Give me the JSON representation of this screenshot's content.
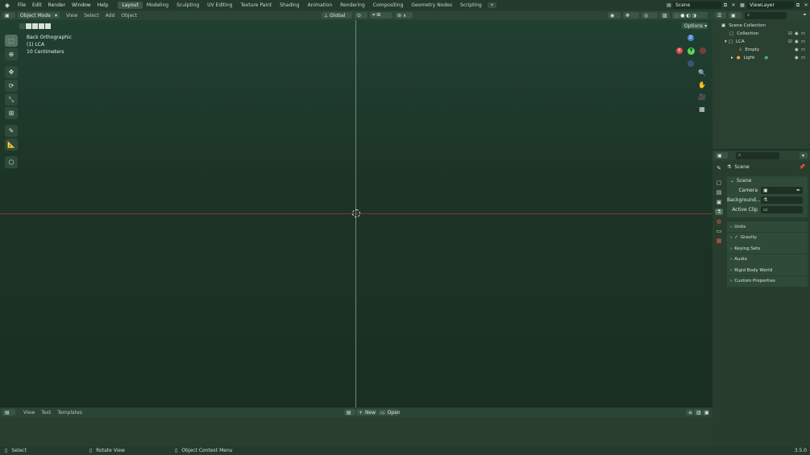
{
  "menubar": {
    "items": [
      "File",
      "Edit",
      "Render",
      "Window",
      "Help"
    ],
    "workspaces": [
      "Layout",
      "Modeling",
      "Sculpting",
      "UV Editing",
      "Texture Paint",
      "Shading",
      "Animation",
      "Rendering",
      "Compositing",
      "Geometry Nodes",
      "Scripting"
    ],
    "active_workspace": "Layout",
    "add_workspace": "+",
    "scene": "Scene",
    "view_layer": "ViewLayer"
  },
  "viewport_header": {
    "mode": "Object Mode",
    "menus": [
      "View",
      "Select",
      "Add",
      "Object"
    ],
    "orientation": "Global",
    "options_label": "Options"
  },
  "viewport": {
    "view_name": "Back Orthographic",
    "collection": "(1) LCA",
    "scale": "10 Centimeters",
    "gizmo": {
      "x": "X",
      "y": "Y",
      "z": "Z"
    }
  },
  "text_editor": {
    "menus": [
      "View",
      "Text",
      "Templates"
    ],
    "new_label": "New",
    "open_label": "Open"
  },
  "status": {
    "select": "Select",
    "rotate": "Rotate View",
    "context": "Object Context Menu",
    "version": "3.5.0"
  },
  "outliner": {
    "rows": [
      "Scene Collection",
      "Collection",
      "LCA",
      "Empty",
      "Light"
    ]
  },
  "properties": {
    "object_name": "Scene",
    "panel_title": "Scene",
    "fields": [
      "Camera",
      "Background...",
      "Active Clip"
    ],
    "sections": [
      "Units",
      "Gravity",
      "Keying Sets",
      "Audio",
      "Rigid Body World",
      "Custom Properties"
    ]
  },
  "colors": {
    "axis_x": "#e04848",
    "axis_y": "#5fd45a",
    "axis_z": "#4b86cf",
    "theme_dark": "#1d3526"
  }
}
